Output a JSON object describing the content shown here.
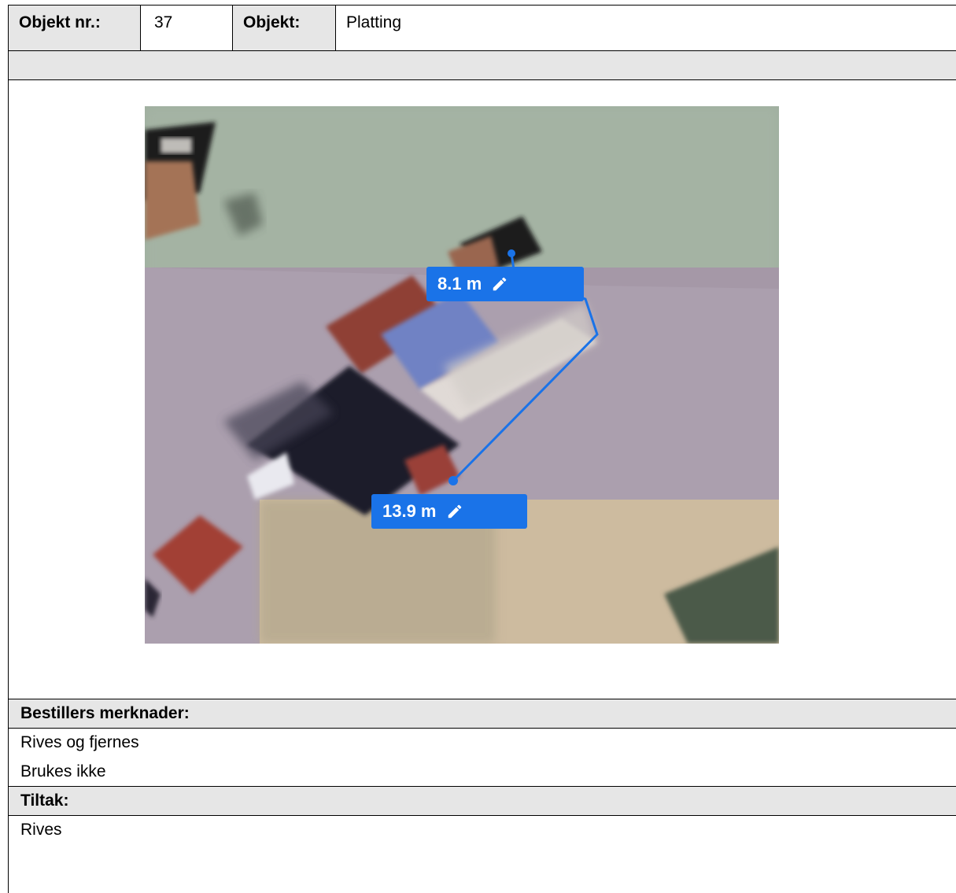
{
  "header": {
    "objekt_nr_label": "Objekt nr.:",
    "objekt_nr_value": "37",
    "objekt_label": "Objekt:",
    "objekt_value": "Platting"
  },
  "image": {
    "measurements": [
      {
        "value": "8.1 m",
        "icon": "pencil-icon"
      },
      {
        "value": "13.9 m",
        "icon": "pencil-icon"
      }
    ],
    "accent_color": "#1a73e8"
  },
  "bestillers_merknader": {
    "heading": "Bestillers merknader:",
    "lines": [
      "Rives og fjernes",
      "Brukes ikke"
    ]
  },
  "tiltak": {
    "heading": "Tiltak:",
    "lines": [
      "Rives"
    ]
  }
}
